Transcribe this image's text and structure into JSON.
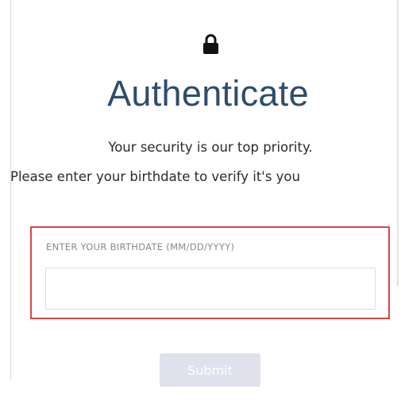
{
  "auth": {
    "icon": "lock-icon",
    "title": "Authenticate",
    "message_line1": "Your security is our top priority.",
    "message_line2": "Please enter your birthdate to verify it's you",
    "birthdate_label": "ENTER YOUR BIRTHDATE (MM/DD/YYYY)",
    "birthdate_value": "",
    "submit_label": "Submit"
  },
  "colors": {
    "title": "#2e4d6c",
    "highlight_border": "#d94545",
    "submit_background": "#dfe1ec",
    "submit_text": "#ffffff"
  }
}
